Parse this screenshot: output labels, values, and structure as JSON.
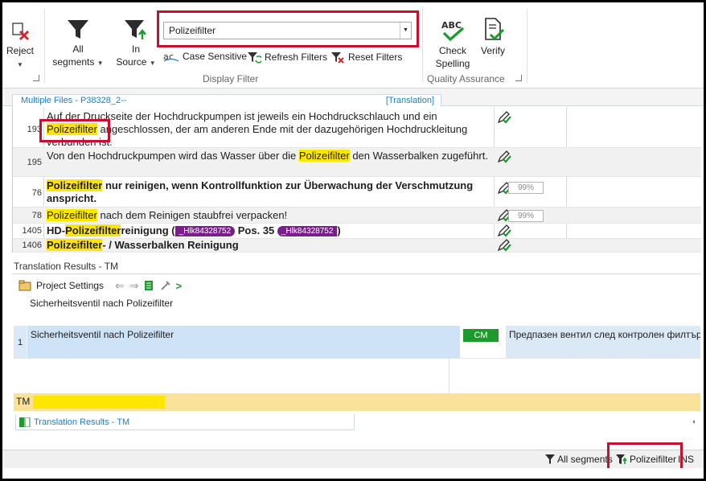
{
  "ribbon": {
    "reject": {
      "label": "Reject"
    },
    "all_segments": {
      "line1": "All",
      "line2": "segments"
    },
    "in_source": {
      "line1": "In",
      "line2": "Source"
    },
    "filter_value": "Polizeifilter",
    "case_sensitive": "Case Sensitive",
    "refresh_filters": "Refresh Filters",
    "reset_filters": "Reset Filters",
    "display_filter_label": "Display Filter",
    "check_spelling": {
      "line1": "Check",
      "line2": "Spelling"
    },
    "verify": "Verify",
    "qa_label": "Quality Assurance"
  },
  "editor": {
    "doc_tab": "Multiple Files - P38328_2--",
    "doc_status": "[Translation]",
    "segments": [
      {
        "num": "193",
        "bold": false,
        "parts": [
          [
            "Auf der Druckseite der Hochdruckpumpen ist jeweils ein Hochdruckschlauch und ein ",
            0
          ],
          [
            "Polizeifilter",
            1
          ],
          [
            " angeschlossen, der am anderen Ende mit der dazugehörigen Hochdruckleitung verbunden ist.",
            0
          ]
        ]
      },
      {
        "num": "195",
        "bold": false,
        "parts": [
          [
            "Von den Hochdruckpumpen wird das Wasser über die ",
            0
          ],
          [
            "Polizeifilter",
            1
          ],
          [
            " den Wasserbalken zugeführt.",
            0
          ]
        ]
      },
      {
        "num": "76",
        "bold": true,
        "match": "99%",
        "parts": [
          [
            "Polizeifilter",
            1
          ],
          [
            " nur reinigen, wenn Kontrollfunktion zur Überwachung der Verschmutzung anspricht.",
            0
          ]
        ]
      },
      {
        "num": "78",
        "bold": false,
        "match": "99%",
        "parts": [
          [
            "Polizeifilter",
            1
          ],
          [
            " nach dem Reinigen staubfrei verpacken!",
            0
          ]
        ]
      },
      {
        "num": "1405",
        "bold": true,
        "parts": [
          [
            "HD-",
            0
          ],
          [
            "Polizeifilter",
            1
          ],
          [
            "reinigung (",
            0
          ],
          [
            "_Hlk84328752",
            2
          ],
          [
            " Pos. 35 ",
            0
          ],
          [
            "_Hlk84328752",
            3
          ],
          [
            ")",
            0
          ]
        ]
      },
      {
        "num": "1406",
        "bold": true,
        "parts": [
          [
            "Polizeifilter",
            1
          ],
          [
            "- / Wasserbalken Reinigung",
            0
          ]
        ]
      }
    ]
  },
  "results": {
    "title": "Translation Results - TM",
    "project_settings": "Project Settings",
    "source_text": "Sicherheitsventil nach Polizeifilter",
    "row": {
      "num": "1",
      "source": "Sicherheitsventil nach Polizeifilter",
      "badge": "CM",
      "target": "Предпазен вентил след контролен филтър"
    },
    "tm_label": "TM",
    "bottom_tab": "Translation Results - TM"
  },
  "statusbar": {
    "all_segments": "All segments",
    "filter": "Polizeifilter",
    "ins": "INS"
  },
  "colors": {
    "highlight": "#ffe600",
    "tag": "#7a1f8a",
    "redbox": "#c8102e",
    "cm": "#1c9a2e"
  }
}
